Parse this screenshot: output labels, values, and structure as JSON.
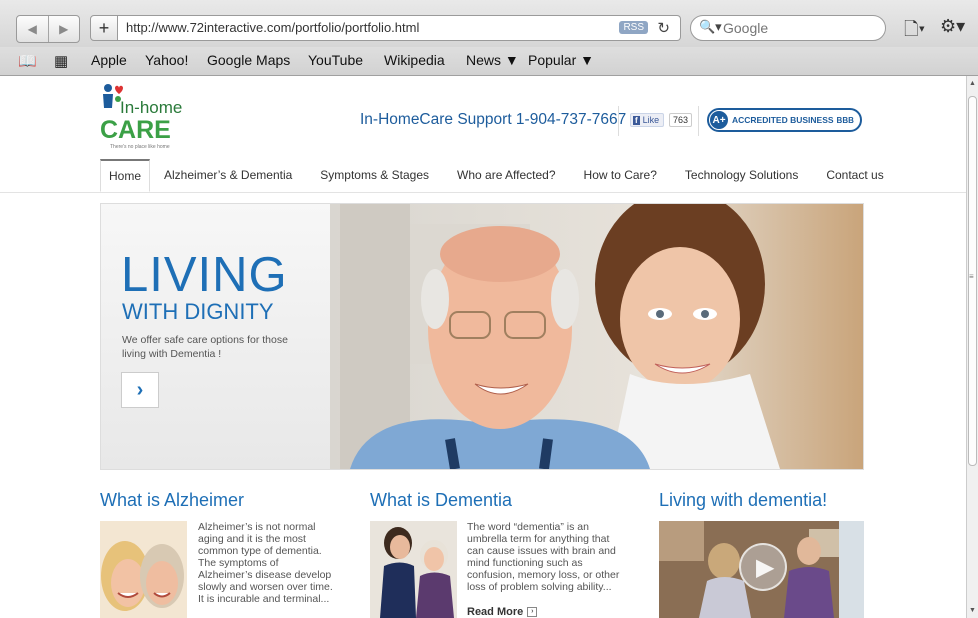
{
  "browser": {
    "url": "http://www.72interactive.com/portfolio/portfolio.html",
    "rss_label": "RSS",
    "search_placeholder": "Google",
    "bookmarks": [
      "Apple",
      "Yahoo!",
      "Google Maps",
      "YouTube",
      "Wikipedia",
      "News ▼",
      "Popular ▼"
    ]
  },
  "header": {
    "logo_in_home": "In-home",
    "logo_care": "CARE",
    "logo_tagline": "There's no place like home",
    "support": "In-HomeCare Support 1-904-737-7667",
    "fb_like": "Like",
    "fb_count": "763",
    "bbb_grade": "A+",
    "bbb_text": "ACCREDITED BUSINESS",
    "bbb_logo": "BBB"
  },
  "nav": [
    "Home",
    "Alzheimer’s & Dementia",
    "Symptoms & Stages",
    "Who are Affected?",
    "How to Care?",
    "Technology Solutions",
    "Contact us"
  ],
  "hero": {
    "title": "LIVING",
    "subtitle": "WITH DIGNITY",
    "description": "We offer safe care options for those living with Dementia !"
  },
  "sections": {
    "alzheimer": {
      "title": "What is Alzheimer",
      "text": "Alzheimer’s is not normal aging and it is the most common type of dementia. The symptoms of Alzheimer’s disease develop slowly and worsen over time. It is incurable and terminal..."
    },
    "dementia": {
      "title": "What is Dementia",
      "text": "The word “dementia” is an umbrella term for anything that can cause issues with brain and mind functioning such as confusion, memory loss, or other loss of problem solving ability...",
      "read_more": "Read More"
    },
    "living": {
      "title": "Living with dementia!"
    }
  },
  "colors": {
    "brand_blue": "#1e6fb6",
    "brand_green": "#3ba046"
  }
}
